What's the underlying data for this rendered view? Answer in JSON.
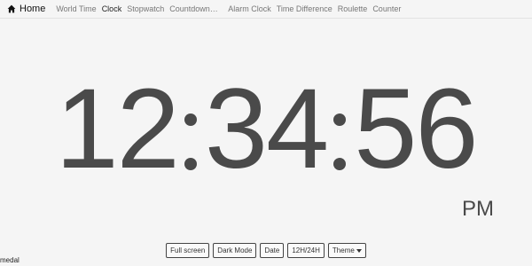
{
  "nav": {
    "brand": "Home",
    "links": [
      "World Time",
      "Clock",
      "Stopwatch",
      "Countdown Timer",
      "Alarm Clock",
      "Time Difference",
      "Roulette",
      "Counter"
    ]
  },
  "clock": {
    "hours": "12",
    "minutes": "34",
    "seconds": "56",
    "ampm": "PM"
  },
  "toolbar": {
    "fullscreen": "Full screen",
    "dark_mode": "Dark Mode",
    "date": "Date",
    "hour_format": "12H/24H",
    "theme": "Theme"
  },
  "footer": {
    "medal": "medal"
  }
}
